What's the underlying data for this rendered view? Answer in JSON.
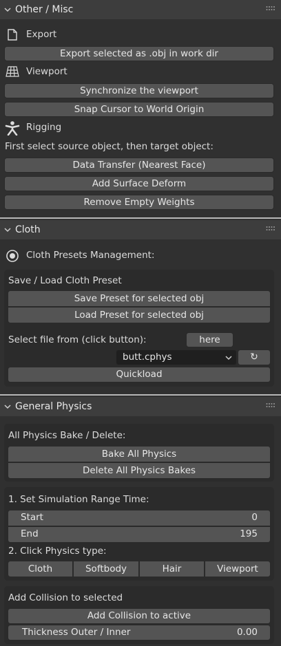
{
  "misc": {
    "title": "Other / Misc",
    "export_label": "Export",
    "export_button": "Export selected as .obj in work dir",
    "viewport_label": "Viewport",
    "sync_button": "Synchronize the viewport",
    "snap_button": "Snap Cursor to World Origin",
    "rigging_label": "Rigging",
    "rigging_hint": "First select source object, then target object:",
    "data_transfer_button": "Data Transfer (Nearest Face)",
    "surface_deform_button": "Add Surface Deform",
    "remove_weights_button": "Remove Empty Weights"
  },
  "cloth": {
    "title": "Cloth",
    "presets_label": "Cloth Presets Management:",
    "save_load_label": "Save / Load Cloth Preset",
    "save_button": "Save Preset for selected obj",
    "load_button": "Load Preset for selected obj",
    "select_file_label": "Select file from (click button):",
    "here_button": "here",
    "file_select_value": "butt.cphys",
    "refresh_icon": "↻",
    "quickload_button": "Quickload"
  },
  "physics": {
    "title": "General Physics",
    "bake_delete_label": "All Physics Bake / Delete:",
    "bake_button": "Bake All Physics",
    "delete_button": "Delete All Physics Bakes",
    "range_label": "1. Set Simulation Range Time:",
    "start_label": "Start",
    "start_value": "0",
    "end_label": "End",
    "end_value": "195",
    "type_label": "2. Click Physics type:",
    "types": [
      "Cloth",
      "Softbody",
      "Hair",
      "Viewport"
    ],
    "collision_label": "Add Collision to selected",
    "add_collision_button": "Add Collision to active",
    "thickness_label": "Thickness Outer / Inner",
    "thickness_value": "0.00"
  },
  "icons": {
    "chevron": "chevron-down-icon",
    "grip": "drag-grip-icon",
    "export": "document-icon",
    "viewport": "grid-icon",
    "rigging": "armature-icon",
    "cloth": "radio-icon",
    "dropdown": "chevron-down-icon",
    "refresh": "refresh-icon"
  },
  "colors": {
    "background": "#303030",
    "header": "#3d3d3d",
    "button": "#545454",
    "box": "#2b2b2b",
    "text": "#e6e6e6"
  }
}
